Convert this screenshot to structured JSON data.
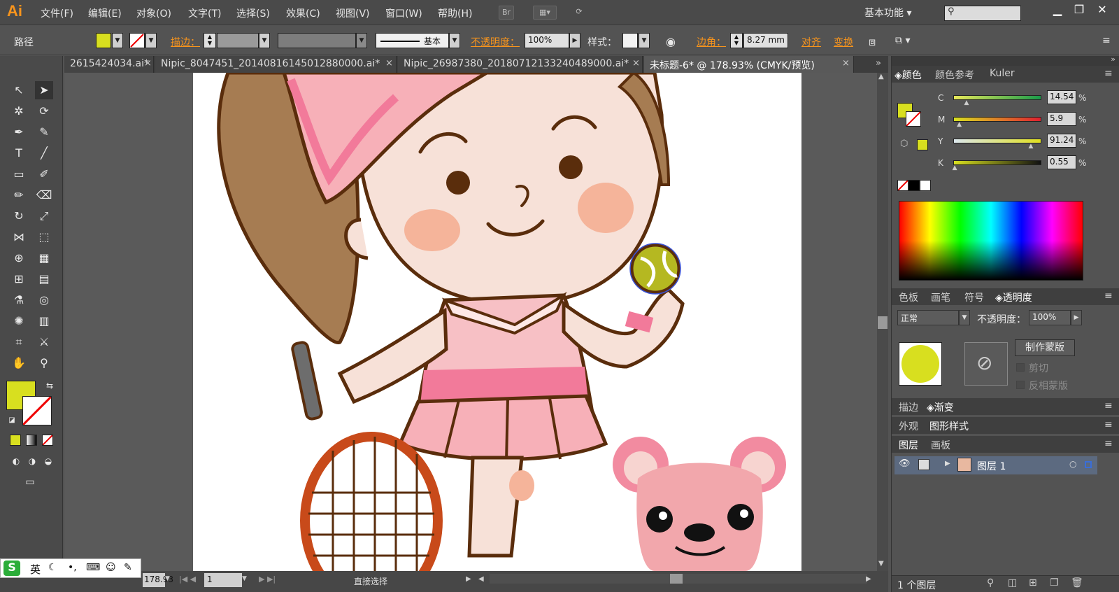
{
  "app": {
    "logo": "Ai",
    "menu": [
      "文件(F)",
      "编辑(E)",
      "对象(O)",
      "文字(T)",
      "选择(S)",
      "效果(C)",
      "视图(V)",
      "窗口(W)",
      "帮助(H)"
    ],
    "br_label": "Br",
    "workspace": "基本功能"
  },
  "control": {
    "object_type": "路径",
    "stroke_label": "描边：",
    "stroke_style": "基本",
    "opacity_label": "不透明度：",
    "opacity_value": "100%",
    "style_label": "样式：",
    "corner_label": "边角：",
    "corner_value": "8.27 mm",
    "align_label": "对齐",
    "transform_label": "变换"
  },
  "tabs": [
    {
      "label": "2615424034.ai*"
    },
    {
      "label": "Nipic_8047451_20140816145012880000.ai*"
    },
    {
      "label": "Nipic_26987380_20180712133240489000.ai*"
    },
    {
      "label": "未标题-6* @ 178.93% (CMYK/预览)"
    }
  ],
  "color_panel": {
    "tabs": [
      "颜色",
      "颜色参考",
      "Kuler"
    ],
    "channels": [
      {
        "name": "C",
        "value": "14.54",
        "fraction": 0.1454
      },
      {
        "name": "M",
        "value": "5.9",
        "fraction": 0.059
      },
      {
        "name": "Y",
        "value": "91.24",
        "fraction": 0.9124
      },
      {
        "name": "K",
        "value": "0.55",
        "fraction": 0.0055
      }
    ],
    "percent": "%"
  },
  "transparency_panel": {
    "tabs": [
      "色板",
      "画笔",
      "符号",
      "透明度"
    ],
    "blend_mode": "正常",
    "opacity_label": "不透明度：",
    "opacity_value": "100%",
    "make_mask": "制作蒙版",
    "clip": "剪切",
    "invert_mask": "反相蒙版"
  },
  "stroke_panel": {
    "tabs": [
      "描边",
      "渐变"
    ]
  },
  "appearance_panel": {
    "tabs": [
      "外观",
      "图形样式"
    ]
  },
  "layers_panel": {
    "tabs": [
      "图层",
      "画板"
    ],
    "layer_name": "图层 1",
    "layer_count": "1 个图层"
  },
  "status": {
    "zoom": "178.93",
    "artboard_num": "1",
    "tool_name": "直接选择"
  },
  "ime": {
    "lang": "英"
  },
  "colors": {
    "fill": "#d8df1f",
    "accent": "#f7941d"
  }
}
